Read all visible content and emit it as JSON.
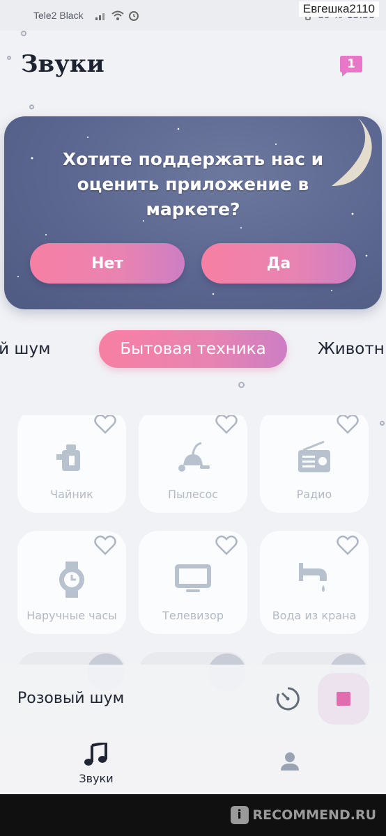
{
  "status_bar": {
    "carrier": "Tele2 Black",
    "battery": "89 %",
    "time": "13:38",
    "username_overlay": "Евгешка2110"
  },
  "header": {
    "title": "Звуки",
    "notification_count": "1"
  },
  "rate_card": {
    "question": "Хотите поддержать нас и оценить приложение в маркете?",
    "no_label": "Нет",
    "yes_label": "Да"
  },
  "categories": {
    "prev": "ый шум",
    "active": "Бытовая техника",
    "next": "Животн"
  },
  "sounds": [
    {
      "label": "Чайник",
      "icon": "kettle-icon"
    },
    {
      "label": "Пылесос",
      "icon": "vacuum-icon"
    },
    {
      "label": "Радио",
      "icon": "radio-icon"
    },
    {
      "label": "Наручные часы",
      "icon": "watch-icon"
    },
    {
      "label": "Телевизор",
      "icon": "tv-icon"
    },
    {
      "label": "Вода из крана",
      "icon": "faucet-icon"
    }
  ],
  "player": {
    "now_playing": "Розовый шум"
  },
  "bottom_nav": {
    "sounds_label": "Звуки"
  },
  "watermark": {
    "text": "RECOMMEND.RU"
  },
  "colors": {
    "accent_pink": "#f77fa3",
    "card_bg": "#5b6690",
    "icon_gray": "#b3bac6"
  }
}
